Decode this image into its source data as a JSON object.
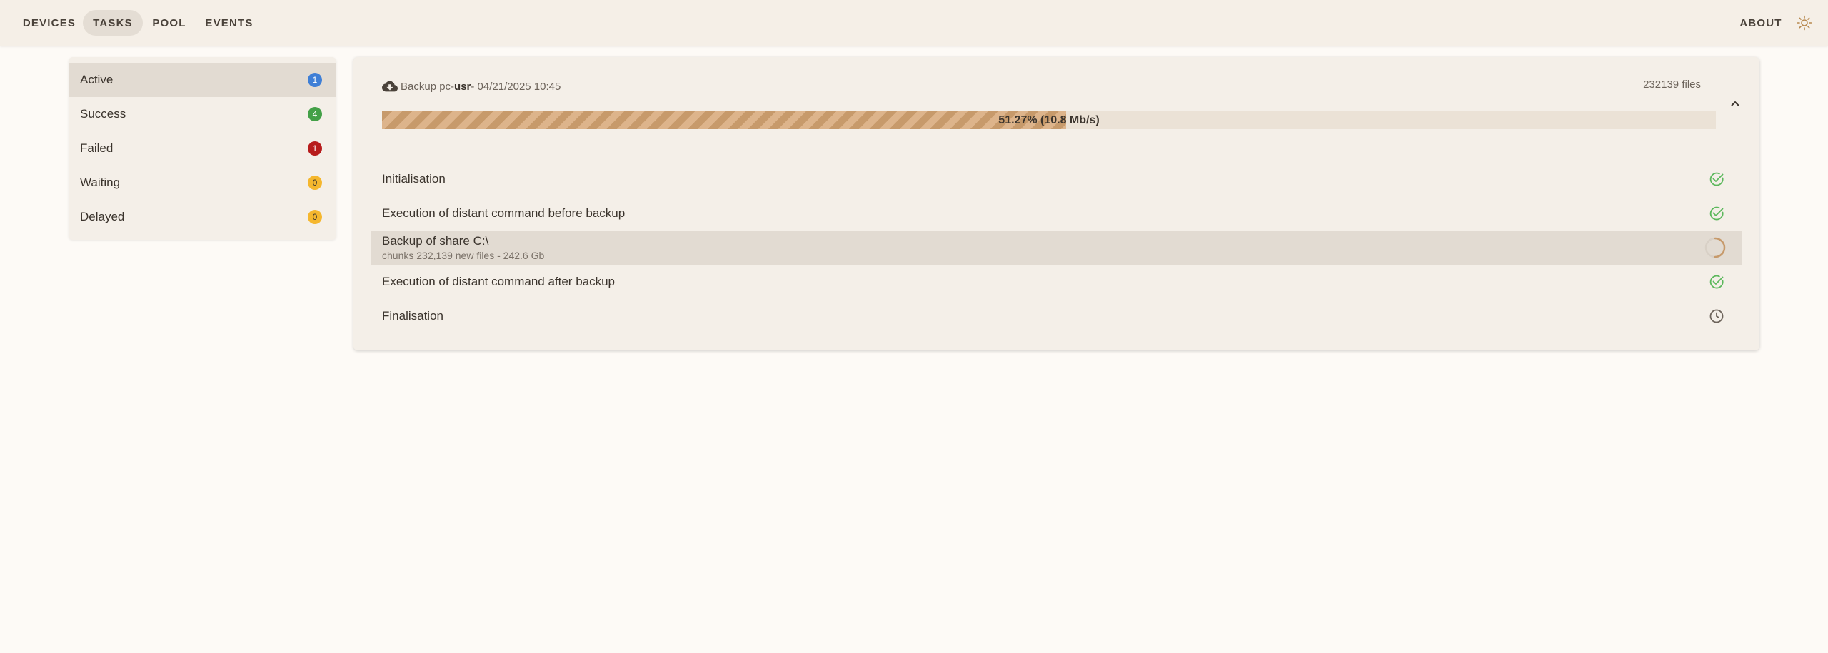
{
  "nav": {
    "items": [
      "DEVICES",
      "TASKS",
      "POOL",
      "EVENTS"
    ],
    "about": "ABOUT"
  },
  "sidebar": {
    "items": [
      {
        "label": "Active",
        "count": "1",
        "color": "#3f7fd6"
      },
      {
        "label": "Success",
        "count": "4",
        "color": "#43a047"
      },
      {
        "label": "Failed",
        "count": "1",
        "color": "#b71c1c"
      },
      {
        "label": "Waiting",
        "count": "0",
        "color": "#f5b72e"
      },
      {
        "label": "Delayed",
        "count": "0",
        "color": "#f5b72e"
      }
    ]
  },
  "task": {
    "title_prefix": "Backup pc-",
    "host": "usr",
    "date": " - 04/21/2025 10:45",
    "files": "232139 files",
    "progress_percent": 51.27,
    "progress_label": "51.27% (10.8 Mb/s)",
    "steps": [
      {
        "label": "Initialisation",
        "detail": "",
        "status": "done"
      },
      {
        "label": "Execution of distant command before backup",
        "detail": "",
        "status": "done"
      },
      {
        "label": "Backup of share C:\\",
        "detail": "chunks 232,139 new files - 242.6 Gb",
        "status": "running"
      },
      {
        "label": "Execution of distant command after backup",
        "detail": "",
        "status": "done"
      },
      {
        "label": "Finalisation",
        "detail": "",
        "status": "pending"
      }
    ]
  },
  "colors": {
    "success": "#5cb85c",
    "pending": "#6d645b",
    "progress_stripe": "#c79a6b"
  }
}
